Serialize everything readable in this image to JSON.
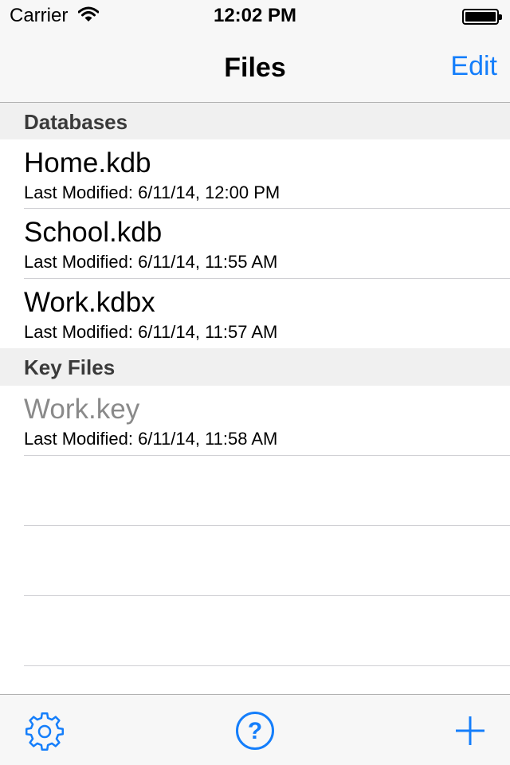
{
  "status_bar": {
    "carrier": "Carrier",
    "time": "12:02 PM"
  },
  "nav": {
    "title": "Files",
    "edit_label": "Edit"
  },
  "sections": [
    {
      "title": "Databases",
      "files": [
        {
          "name": "Home.kdb",
          "modified": "Last Modified: 6/11/14, 12:00 PM"
        },
        {
          "name": "School.kdb",
          "modified": "Last Modified: 6/11/14, 11:55 AM"
        },
        {
          "name": "Work.kdbx",
          "modified": "Last Modified: 6/11/14, 11:57 AM"
        }
      ]
    },
    {
      "title": "Key Files",
      "files": [
        {
          "name": "Work.key",
          "modified": "Last Modified: 6/11/14, 11:58 AM"
        }
      ]
    }
  ],
  "toolbar": {
    "icons": [
      "gear-icon",
      "help-icon",
      "plus-icon"
    ]
  },
  "colors": {
    "accent": "#147efb",
    "bar_background": "#f7f7f7",
    "section_background": "#f0f0f0",
    "dimmed_text": "#8a8a8a"
  }
}
